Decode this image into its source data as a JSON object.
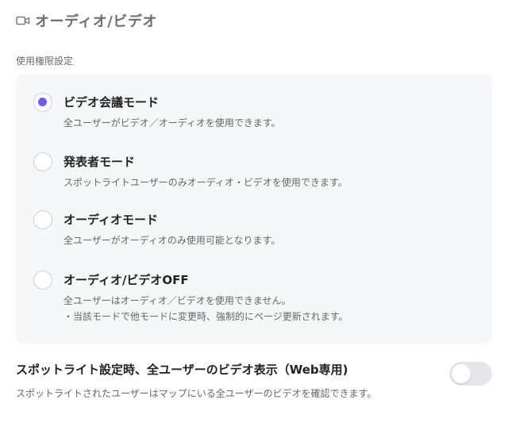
{
  "header": {
    "title": "オーディオ/ビデオ",
    "icon": "video-camera-icon"
  },
  "permission": {
    "label": "使用権限設定",
    "options": [
      {
        "title": "ビデオ会議モード",
        "desc": "全ユーザーがビデオ／オーディオを使用できます。",
        "selected": true
      },
      {
        "title": "発表者モード",
        "desc": "スポットライトユーザーのみオーディオ・ビデオを使用できます。",
        "selected": false
      },
      {
        "title": "オーディオモード",
        "desc": "全ユーザーがオーディオのみ使用可能となります。",
        "selected": false
      },
      {
        "title": "オーディオ/ビデオOFF",
        "desc": "全ユーザーはオーディオ／ビデオを使用できません。",
        "desc2": "・当該モードで他モードに変更時、強制的にページ更新されます。",
        "selected": false
      }
    ]
  },
  "spotlight": {
    "title": "スポットライト設定時、全ユーザーのビデオ表示（Web専用)",
    "desc": "スポットライトされたユーザーはマップにいる全ユーザーのビデオを確認できます。",
    "enabled": false
  },
  "colors": {
    "accent": "#6a5cf0",
    "card_bg": "#f6f7f9",
    "toggle_off": "#e5e6ea"
  }
}
